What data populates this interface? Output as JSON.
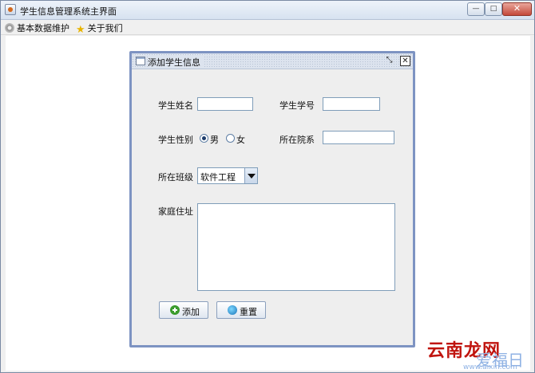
{
  "window": {
    "title": "学生信息管理系统主界面",
    "min_symbol": "—",
    "max_symbol": "□",
    "close_symbol": "✕"
  },
  "menubar": {
    "items": [
      {
        "label": "基本数据维护",
        "icon": "gear-icon"
      },
      {
        "label": "关于我们",
        "icon": "star-icon"
      }
    ]
  },
  "frame": {
    "title": "添加学生信息",
    "restore_symbol": "⤡",
    "close_symbol": "✕"
  },
  "form": {
    "name_label": "学生姓名",
    "name_value": "",
    "id_label": "学生学号",
    "id_value": "",
    "gender_label": "学生性别",
    "gender_options": [
      {
        "label": "男",
        "checked": true
      },
      {
        "label": "女",
        "checked": false
      }
    ],
    "dept_label": "所在院系",
    "dept_value": "",
    "class_label": "所在班级",
    "class_selected": "软件工程",
    "address_label": "家庭住址",
    "address_value": "",
    "add_button": "添加",
    "reset_button": "重置"
  },
  "watermark": {
    "line1": "云南龙网",
    "line2": "爱福日",
    "line3": "www.aixin.com"
  }
}
